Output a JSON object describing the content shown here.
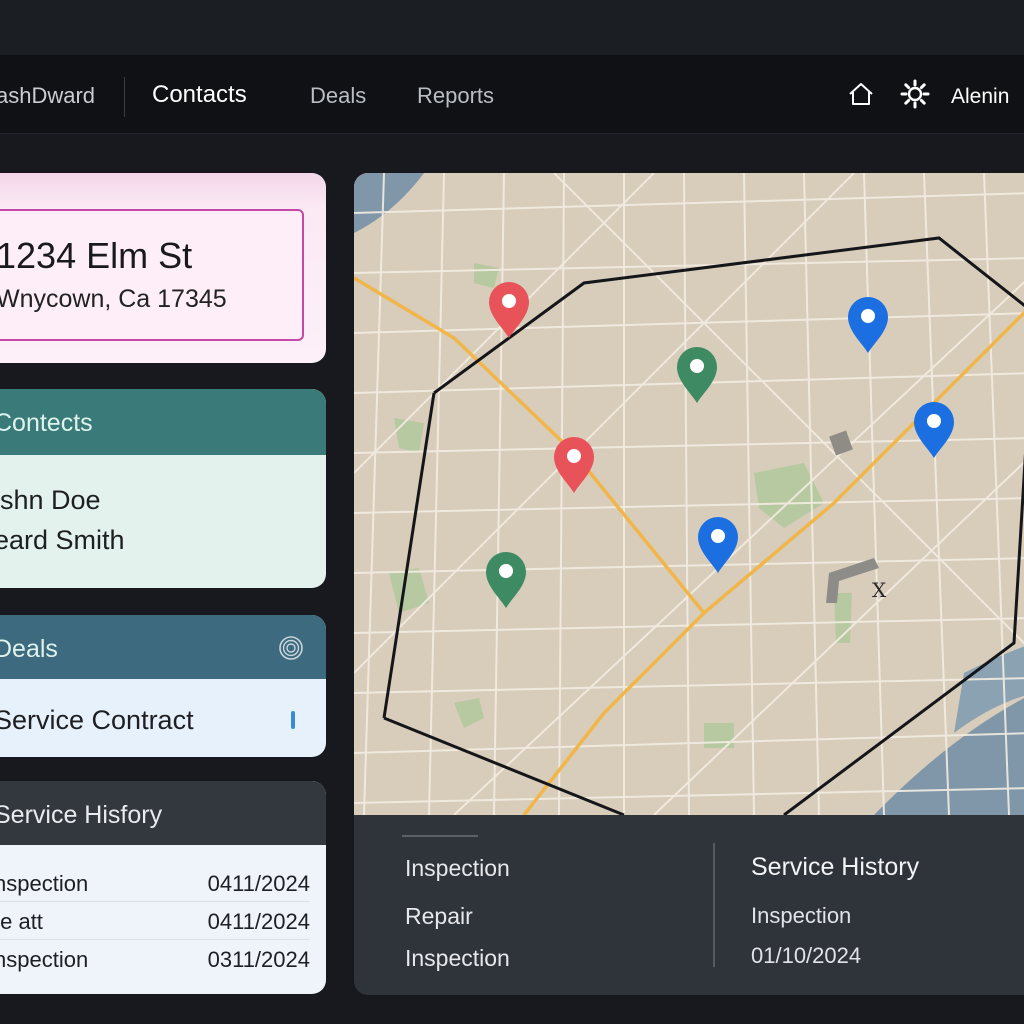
{
  "nav": {
    "brand": "ashDward",
    "links": [
      "Contacts",
      "Deals",
      "Reports"
    ],
    "user": "Alenin"
  },
  "address": {
    "line1": "1234 Elm St",
    "line2": "Wnycown, Ca 17345"
  },
  "contacts": {
    "title": "Contects",
    "items": [
      "ishn Doe",
      "eard Smith"
    ]
  },
  "deals": {
    "title": "Deals",
    "items": [
      "Service Contract"
    ]
  },
  "history": {
    "title": "Service Hisfory",
    "rows": [
      {
        "type": "nspection",
        "date": "0411/2024"
      },
      {
        "type": "te  att",
        "date": "0411/2024"
      },
      {
        "type": "nspection",
        "date": "0311/2024"
      }
    ]
  },
  "map": {
    "marker_label": "X",
    "pins": [
      {
        "color": "#e8535a"
      },
      {
        "color": "#e8535a"
      },
      {
        "color": "#3d8a63"
      },
      {
        "color": "#3d8a63"
      },
      {
        "color": "#1b6fe0"
      },
      {
        "color": "#1b6fe0"
      },
      {
        "color": "#1b6fe0"
      }
    ]
  },
  "detail": {
    "list": [
      "Inspection",
      "Repair",
      "Inspection"
    ],
    "history_title": "Service History",
    "history_type": "Inspection",
    "history_date": "01/10/2024"
  },
  "colors": {
    "accent_pink": "#c547a8",
    "contacts_header": "#3a7a78",
    "deals_header": "#3d6a7e",
    "route": "#f0b64a",
    "water": "#7f97a8"
  }
}
